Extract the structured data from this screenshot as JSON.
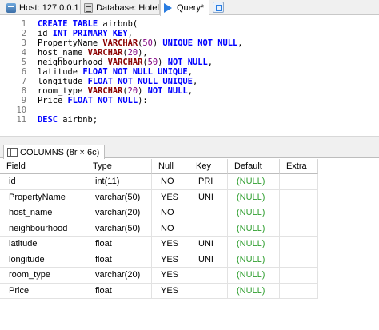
{
  "tabs": {
    "host": "Host: 127.0.0.1",
    "database": "Database: Hotel",
    "query": "Query*"
  },
  "editor": {
    "lines": [
      {
        "n": "1",
        "tokens": [
          [
            "kw",
            "CREATE TABLE "
          ],
          [
            "ident",
            "airbnb("
          ]
        ]
      },
      {
        "n": "2",
        "tokens": [
          [
            "ident",
            "id "
          ],
          [
            "kw",
            "INT PRIMARY KEY"
          ],
          [
            "ident",
            ","
          ]
        ]
      },
      {
        "n": "3",
        "tokens": [
          [
            "ident",
            "PropertyName "
          ],
          [
            "ty",
            "VARCHAR"
          ],
          [
            "ident",
            "("
          ],
          [
            "nm",
            "50"
          ],
          [
            "ident",
            ") "
          ],
          [
            "kw",
            "UNIQUE NOT NULL"
          ],
          [
            "ident",
            ","
          ]
        ]
      },
      {
        "n": "4",
        "tokens": [
          [
            "ident",
            "host_name "
          ],
          [
            "ty",
            "VARCHAR"
          ],
          [
            "ident",
            "("
          ],
          [
            "nm",
            "20"
          ],
          [
            "ident",
            "),"
          ]
        ]
      },
      {
        "n": "5",
        "tokens": [
          [
            "ident",
            "neighbourhood "
          ],
          [
            "ty",
            "VARCHAR"
          ],
          [
            "ident",
            "("
          ],
          [
            "nm",
            "50"
          ],
          [
            "ident",
            ") "
          ],
          [
            "kw",
            "NOT NULL"
          ],
          [
            "ident",
            ","
          ]
        ]
      },
      {
        "n": "6",
        "tokens": [
          [
            "ident",
            "latitude "
          ],
          [
            "kw",
            "FLOAT NOT NULL UNIQUE"
          ],
          [
            "ident",
            ","
          ]
        ]
      },
      {
        "n": "7",
        "tokens": [
          [
            "ident",
            "longitude "
          ],
          [
            "kw",
            "FLOAT NOT NULL UNIQUE"
          ],
          [
            "ident",
            ","
          ]
        ]
      },
      {
        "n": "8",
        "tokens": [
          [
            "ident",
            "room_type "
          ],
          [
            "ty",
            "VARCHAR"
          ],
          [
            "ident",
            "("
          ],
          [
            "nm",
            "20"
          ],
          [
            "ident",
            ") "
          ],
          [
            "kw",
            "NOT NULL"
          ],
          [
            "ident",
            ","
          ]
        ]
      },
      {
        "n": "9",
        "tokens": [
          [
            "ident",
            "Price "
          ],
          [
            "kw",
            "FLOAT NOT NULL"
          ],
          [
            "ident",
            "):"
          ]
        ]
      },
      {
        "n": "10",
        "tokens": []
      },
      {
        "n": "11",
        "tokens": [
          [
            "kw",
            "DESC "
          ],
          [
            "ident",
            "airbnb;"
          ]
        ]
      }
    ]
  },
  "results": {
    "tab_label": "COLUMNS (8r × 6c)",
    "headers": [
      "Field",
      "Type",
      "Null",
      "Key",
      "Default",
      "Extra"
    ],
    "rows": [
      [
        "id",
        "int(11)",
        "NO",
        "PRI",
        "(NULL)",
        ""
      ],
      [
        "PropertyName",
        "varchar(50)",
        "YES",
        "UNI",
        "(NULL)",
        ""
      ],
      [
        "host_name",
        "varchar(20)",
        "NO",
        "",
        "(NULL)",
        ""
      ],
      [
        "neighbourhood",
        "varchar(50)",
        "NO",
        "",
        "(NULL)",
        ""
      ],
      [
        "latitude",
        "float",
        "YES",
        "UNI",
        "(NULL)",
        ""
      ],
      [
        "longitude",
        "float",
        "YES",
        "UNI",
        "(NULL)",
        ""
      ],
      [
        "room_type",
        "varchar(20)",
        "YES",
        "",
        "(NULL)",
        ""
      ],
      [
        "Price",
        "float",
        "YES",
        "",
        "(NULL)",
        ""
      ]
    ]
  },
  "colors": {
    "keyword": "#0000ff",
    "type": "#8b0000",
    "number": "#800080",
    "null_value": "#2e9e2e"
  }
}
